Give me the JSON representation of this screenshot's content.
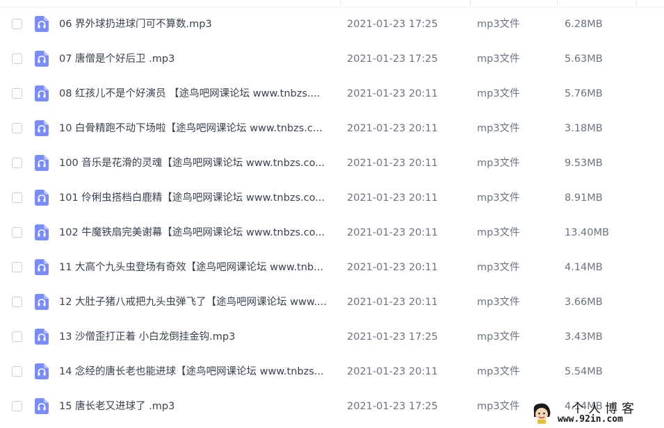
{
  "files": [
    {
      "name": "06 界外球扔进球门可不算数.mp3",
      "date": "2021-01-23 17:25",
      "type": "mp3文件",
      "size": "6.28MB"
    },
    {
      "name": "07 唐僧是个好后卫  .mp3",
      "date": "2021-01-23 17:25",
      "type": "mp3文件",
      "size": "5.63MB"
    },
    {
      "name": "08 红孩儿不是个好演员  【途鸟吧网课论坛 www.tnbzs....",
      "date": "2021-01-23 20:11",
      "type": "mp3文件",
      "size": "5.76MB"
    },
    {
      "name": "10 白骨精跑不动下场啦【途鸟吧网课论坛 www.tnbzs.c...",
      "date": "2021-01-23 20:11",
      "type": "mp3文件",
      "size": "3.18MB"
    },
    {
      "name": "100 音乐是花滑的灵魂【途鸟吧网课论坛 www.tnbzs.co...",
      "date": "2021-01-23 20:11",
      "type": "mp3文件",
      "size": "9.53MB"
    },
    {
      "name": "101 伶俐虫搭档白鹿精【途鸟吧网课论坛 www.tnbzs.co...",
      "date": "2021-01-23 20:11",
      "type": "mp3文件",
      "size": "8.91MB"
    },
    {
      "name": "102 牛魔铁扇完美谢幕【途鸟吧网课论坛 www.tnbzs.co...",
      "date": "2021-01-23 20:11",
      "type": "mp3文件",
      "size": "13.40MB"
    },
    {
      "name": "11 大高个九头虫登场有奇效【途鸟吧网课论坛 www.tnb...",
      "date": "2021-01-23 20:11",
      "type": "mp3文件",
      "size": "4.14MB"
    },
    {
      "name": "12 大肚子猪八戒把九头虫弹飞了【途鸟吧网课论坛 www....",
      "date": "2021-01-23 20:11",
      "type": "mp3文件",
      "size": "3.66MB"
    },
    {
      "name": "13 沙僧歪打正着 小白龙倒挂金钩.mp3",
      "date": "2021-01-23 17:25",
      "type": "mp3文件",
      "size": "3.43MB"
    },
    {
      "name": "14 念经的唐长老也能进球【途鸟吧网课论坛 www.tnbzs...",
      "date": "2021-01-23 20:11",
      "type": "mp3文件",
      "size": "5.54MB"
    },
    {
      "name": "15 唐长老又进球了  .mp3",
      "date": "2021-01-23 17:25",
      "type": "mp3文件",
      "size": "4.14MB"
    }
  ],
  "watermark": {
    "title": "个人博客",
    "url": "www.92in.com"
  },
  "colors": {
    "icon": "#7b8cf5",
    "text": "#3a4150",
    "muted": "#6b7280",
    "checkbox_border": "#c9ced8"
  }
}
